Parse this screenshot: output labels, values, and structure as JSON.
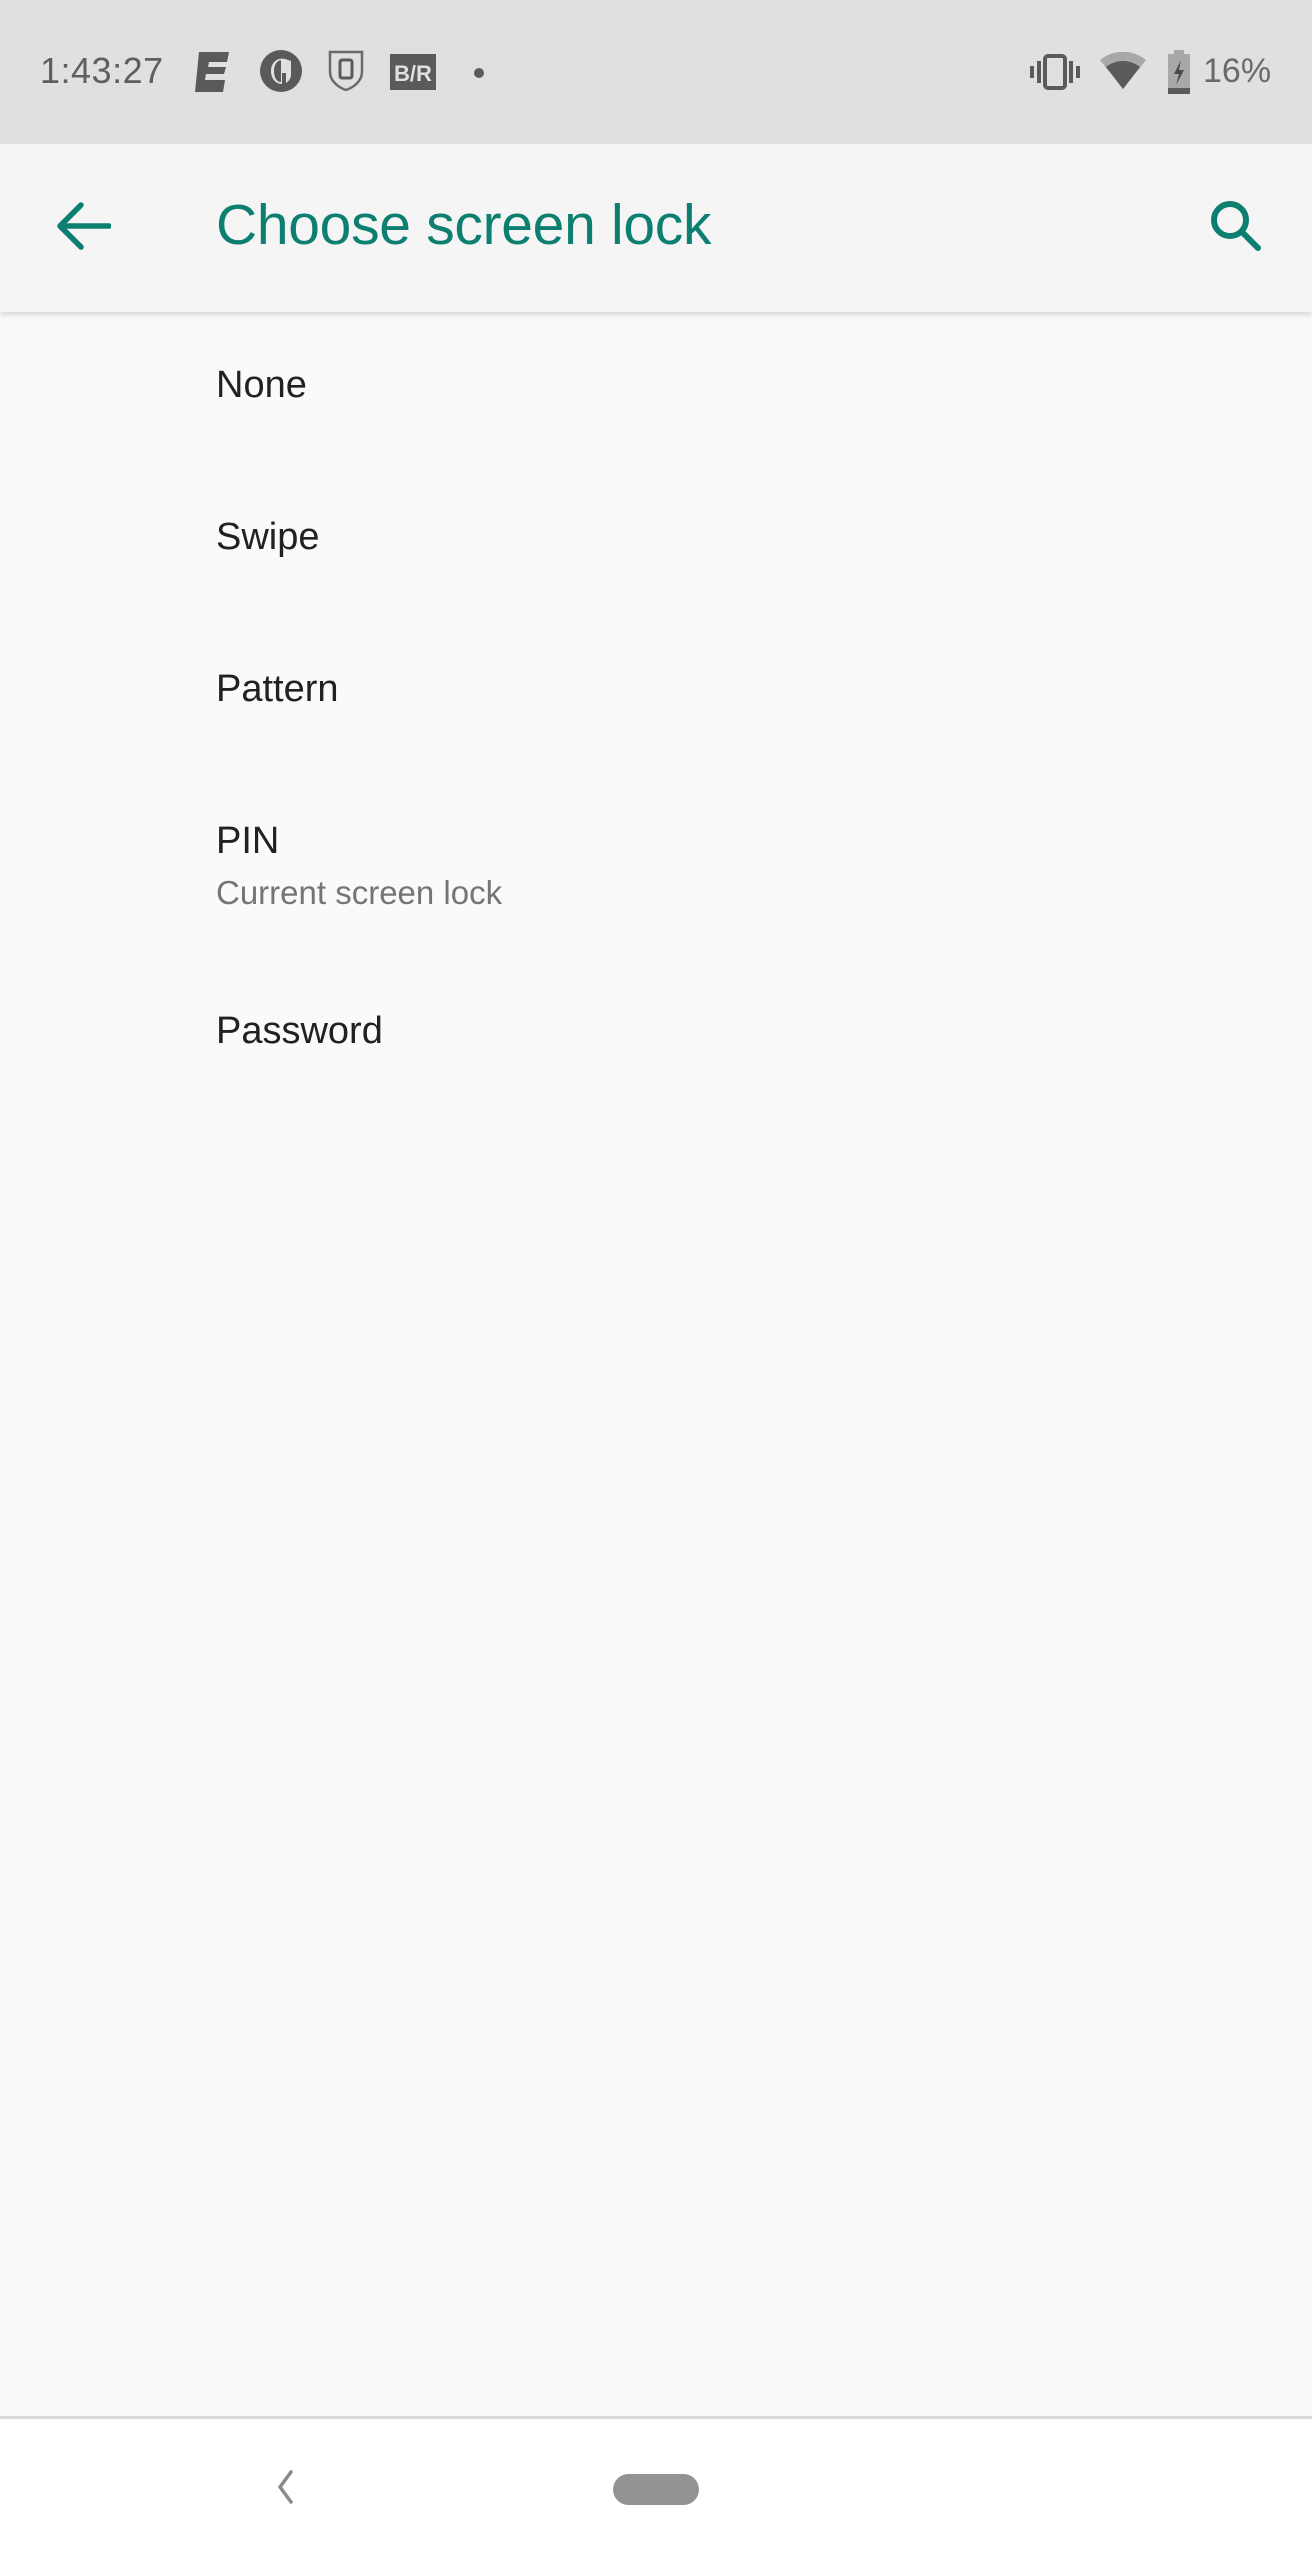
{
  "status_bar": {
    "time": "1:43:27",
    "notification_icons": [
      "espn-icon",
      "guardian-icon",
      "device-shield-icon",
      "bleacher-report-icon",
      "more-notifications-dot-icon"
    ],
    "system_icons": [
      "vibrate-icon",
      "wifi-icon",
      "battery-charging-icon"
    ],
    "battery_percent": "16%"
  },
  "app_bar": {
    "title": "Choose screen lock",
    "back_icon": "arrow-back-icon",
    "search_icon": "search-icon",
    "accent_color": "#0d7f70"
  },
  "options": [
    {
      "label": "None",
      "summary": ""
    },
    {
      "label": "Swipe",
      "summary": ""
    },
    {
      "label": "Pattern",
      "summary": ""
    },
    {
      "label": "PIN",
      "summary": "Current screen lock"
    },
    {
      "label": "Password",
      "summary": ""
    }
  ],
  "nav_bar": {
    "back_icon": "nav-back-chevron-icon",
    "home_icon": "home-pill-icon"
  }
}
